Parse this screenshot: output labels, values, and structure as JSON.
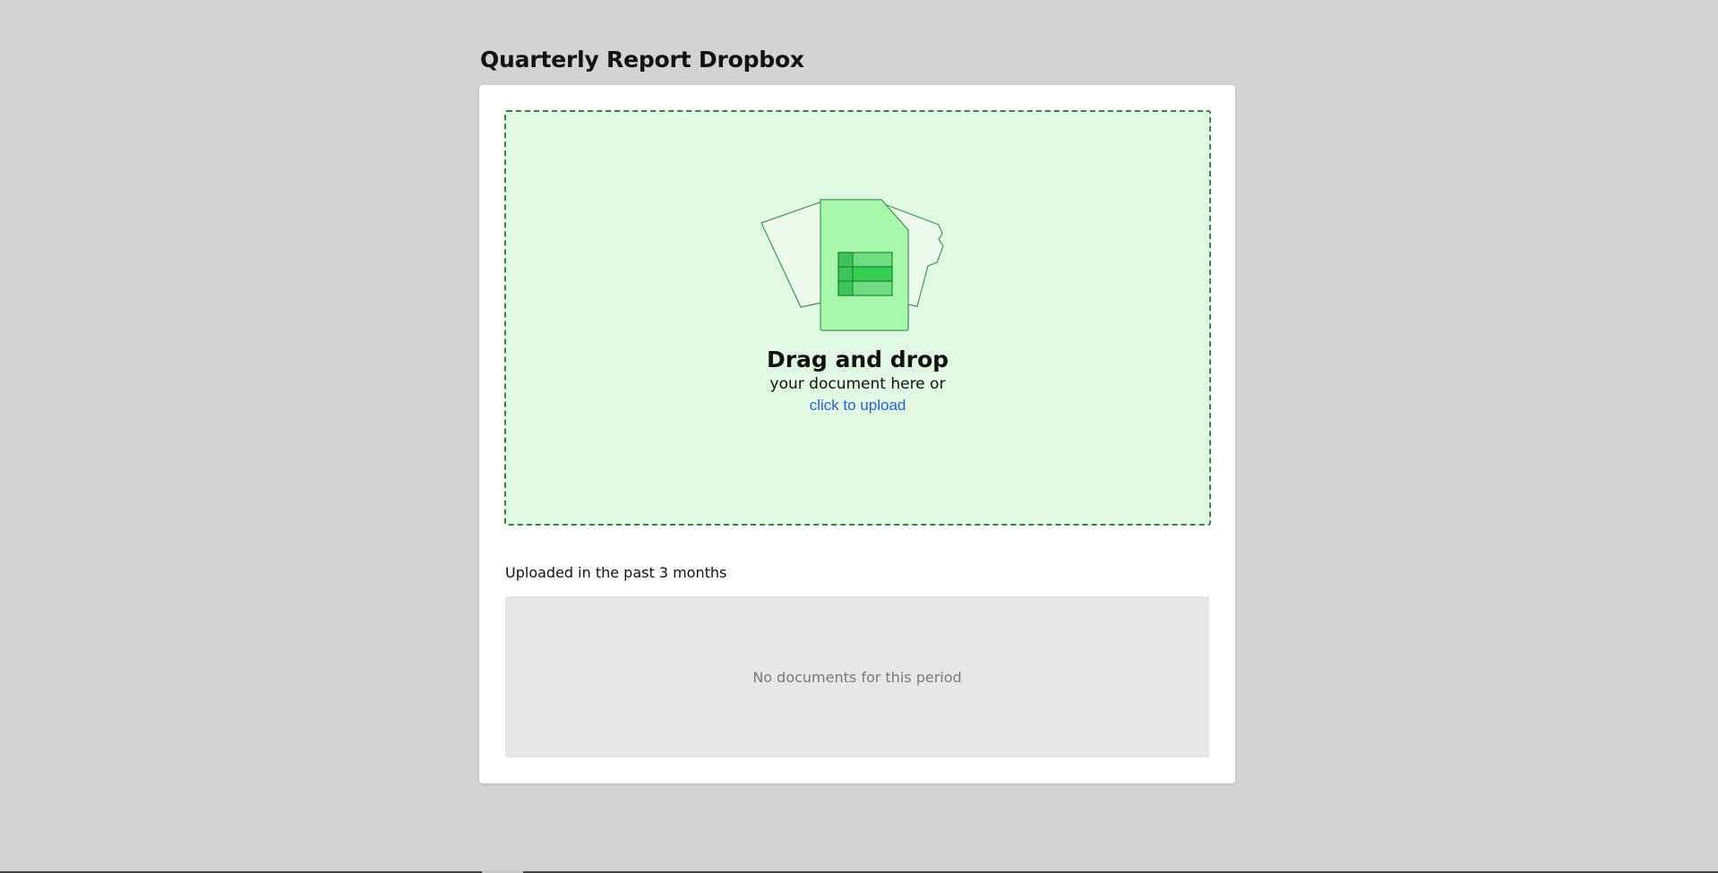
{
  "page": {
    "title": "Quarterly Report Dropbox"
  },
  "dropzone": {
    "heading": "Drag and drop",
    "subtext": "your document here or",
    "link_text": "click to upload",
    "icon": "spreadsheet-document-icon",
    "accent_color": "#2e8b3e",
    "background_color": "#e1f8e3"
  },
  "uploads": {
    "section_label": "Uploaded in the past 3 months",
    "empty_message": "No documents for this period"
  },
  "colors": {
    "page_background": "#d3d3d3",
    "card_background": "#ffffff",
    "link": "#2b5fd9",
    "empty_panel": "#e7e7e7"
  }
}
